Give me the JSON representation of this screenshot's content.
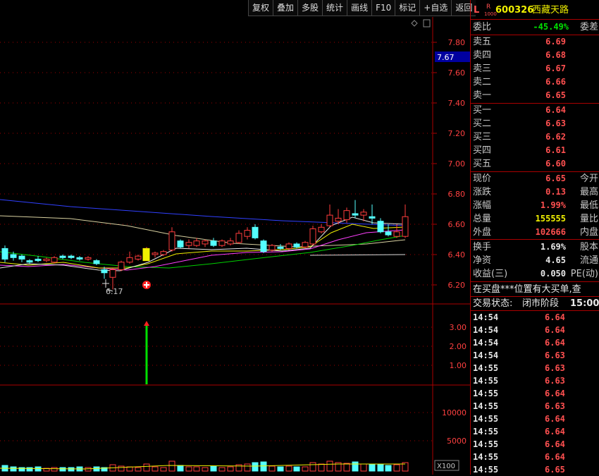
{
  "toolbar": [
    "复权",
    "叠加",
    "多股",
    "统计",
    "画线",
    "F10",
    "标记",
    "+自选",
    "返回"
  ],
  "stock": {
    "prefix": "L",
    "r_label": "R",
    "r_sub": "1000",
    "code": "600326",
    "name": "西藏天路"
  },
  "price_axis": {
    "ticks": [
      "7.80",
      "7.60",
      "7.40",
      "7.20",
      "7.00",
      "6.80",
      "6.60",
      "6.40",
      "6.20"
    ],
    "current": "7.67",
    "low_marker": "6.17"
  },
  "indicator_axis": {
    "ticks": [
      "3.00",
      "2.00",
      "1.00"
    ]
  },
  "volume_axis": {
    "ticks": [
      "10000",
      "5000"
    ],
    "unit": "X100"
  },
  "panel": {
    "weibi": {
      "label": "委比",
      "value": "-45.49%",
      "label2": "委差"
    },
    "asks": [
      {
        "label": "卖五",
        "price": "6.69"
      },
      {
        "label": "卖四",
        "price": "6.68"
      },
      {
        "label": "卖三",
        "price": "6.67"
      },
      {
        "label": "卖二",
        "price": "6.66"
      },
      {
        "label": "卖一",
        "price": "6.65"
      }
    ],
    "bids": [
      {
        "label": "买一",
        "price": "6.64"
      },
      {
        "label": "买二",
        "price": "6.63"
      },
      {
        "label": "买三",
        "price": "6.62"
      },
      {
        "label": "买四",
        "price": "6.61"
      },
      {
        "label": "买五",
        "price": "6.60"
      }
    ],
    "quote": [
      {
        "label": "现价",
        "value": "6.65",
        "label2": "今开"
      },
      {
        "label": "涨跌",
        "value": "0.13",
        "label2": "最高"
      },
      {
        "label": "涨幅",
        "value": "1.99%",
        "label2": "最低"
      },
      {
        "label": "总量",
        "value": "155555",
        "label2": "量比"
      },
      {
        "label": "外盘",
        "value": "102666",
        "label2": "内盘"
      }
    ],
    "stats": [
      {
        "label": "换手",
        "value": "1.69%",
        "label2": "股本"
      },
      {
        "label": "净资",
        "value": "4.65",
        "label2": "流通"
      },
      {
        "label": "收益(三)",
        "value": "0.050",
        "label2": "PE(动)"
      }
    ],
    "notice": "在买盘***位置有大买单,查",
    "status": {
      "label": "交易状态:",
      "value": "闭市阶段",
      "time": "15:00:"
    },
    "ticks": [
      {
        "time": "14:54",
        "price": "6.64"
      },
      {
        "time": "14:54",
        "price": "6.64"
      },
      {
        "time": "14:54",
        "price": "6.64"
      },
      {
        "time": "14:54",
        "price": "6.63"
      },
      {
        "time": "14:55",
        "price": "6.63"
      },
      {
        "time": "14:55",
        "price": "6.63"
      },
      {
        "time": "14:55",
        "price": "6.64"
      },
      {
        "time": "14:55",
        "price": "6.63"
      },
      {
        "time": "14:55",
        "price": "6.64"
      },
      {
        "time": "14:55",
        "price": "6.64"
      },
      {
        "time": "14:55",
        "price": "6.64"
      },
      {
        "time": "14:55",
        "price": "6.64"
      },
      {
        "time": "14:55",
        "price": "6.65"
      }
    ]
  },
  "colors": {
    "up": "#ff3c3c",
    "down": "#54ffff",
    "ma_white": "#e8e8e8",
    "ma_yellow": "#f0f000",
    "ma_magenta": "#ff40ff",
    "ma_green": "#00d000",
    "ma_blue": "#3040ff",
    "ma_tan": "#d8d0a0",
    "grid": "#a00000"
  }
}
